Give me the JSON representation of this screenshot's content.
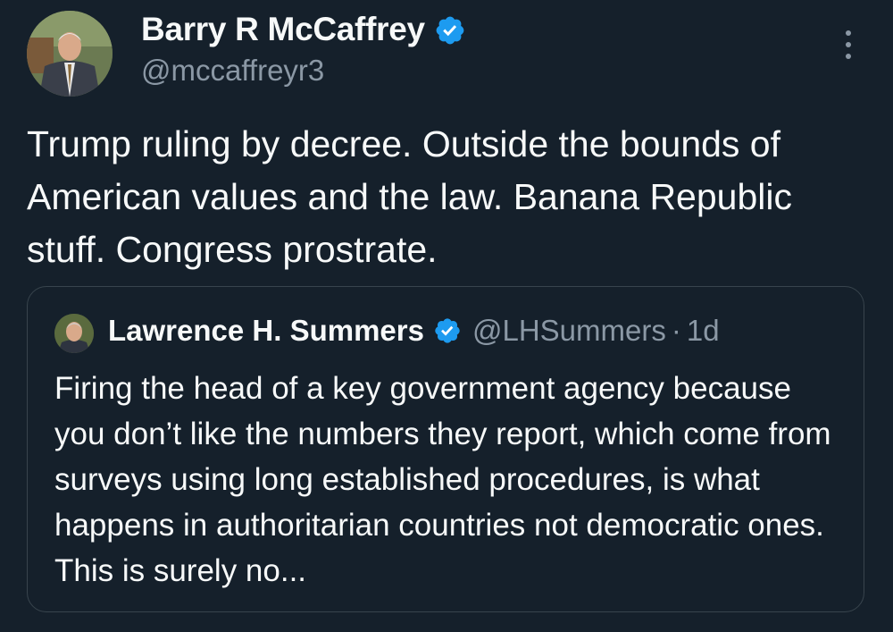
{
  "author": {
    "name": "Barry R McCaffrey",
    "handle": "@mccaffreyr3",
    "verified": true,
    "avatar_icon": "portrait-avatar"
  },
  "tweet": {
    "text": "Trump ruling by decree. Outside the bounds of American values and the law. Banana Republic stuff. Congress prostrate."
  },
  "quoted_tweet": {
    "name": "Lawrence H. Summers",
    "handle": "@LHSummers",
    "separator": "·",
    "time": "1d",
    "verified": true,
    "text": "Firing the head of a key government agency because you don’t like the numbers they report, which come from surveys using long established procedures, is what happens in authoritarian countries not democratic ones. This is surely no..."
  },
  "icons": {
    "verified": "verified-badge-icon",
    "more": "more-options-icon"
  },
  "colors": {
    "background": "#15202b",
    "text": "#f7f9f9",
    "secondary_text": "#8b98a5",
    "verified_blue": "#1d9bf0",
    "border": "#38444d"
  }
}
